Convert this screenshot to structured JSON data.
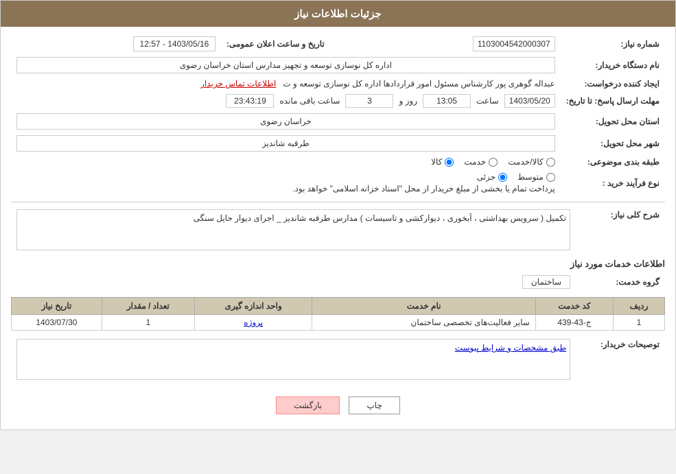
{
  "header": {
    "title": "جزئیات اطلاعات نیاز"
  },
  "fields": {
    "need_number_label": "شماره نیاز:",
    "need_number_value": "1103004542000307",
    "announce_datetime_label": "تاریخ و ساعت اعلان عمومی:",
    "announce_datetime_value": "1403/05/16 - 12:57",
    "buyer_org_label": "نام دستگاه خریدار:",
    "buyer_org_value": "اداره کل نوسازی  توسعه و تجهیز مدارس استان خراسان رضوی",
    "requester_label": "ایجاد کننده درخواست:",
    "requester_value": "عبداله گوهری پور کارشناس مسئول امور قراردادها  اداره کل نوسازی  توسعه و ت",
    "requester_link": "اطلاعات تماس خریدار",
    "response_deadline_label": "مهلت ارسال پاسخ: تا تاریخ:",
    "response_date": "1403/05/20",
    "response_time_label": "ساعت",
    "response_time": "13:05",
    "response_days_label": "روز و",
    "response_days": "3",
    "remaining_time_label": "ساعت باقی مانده",
    "remaining_time": "23:43:19",
    "province_label": "استان محل تحویل:",
    "province_value": "خراسان رضوی",
    "city_label": "شهر محل تحویل:",
    "city_value": "طرقبه شاندیز",
    "category_label": "طبقه بندی موضوعی:",
    "category_kala": "کالا",
    "category_khedmat": "خدمت",
    "category_kala_khedmat": "کالا/خدمت",
    "category_selected": "کالا",
    "process_label": "نوع فرآیند خرید :",
    "process_jozee": "جزئی",
    "process_motavaset": "متوسط",
    "process_note": "پرداخت تمام یا بخشی از مبلغ خریدار از محل \"اسناد خزانه اسلامی\" خواهد بود.",
    "description_label": "شرح کلی نیاز:",
    "description_value": "تکمیل ( سرویس بهداشتی ، آبخوری ، دیوارکشی و تاسیسات ) مدارس طرقبه شاندیز _ اجرای دیوار حایل سنگی",
    "services_section_label": "اطلاعات خدمات مورد نیاز",
    "service_group_label": "گروه خدمت:",
    "service_group_value": "ساختمان",
    "table_headers": {
      "radif": "ردیف",
      "code": "کد خدمت",
      "name": "نام خدمت",
      "unit": "واحد اندازه گیری",
      "quantity": "تعداد / مقدار",
      "date": "تاریخ نیاز"
    },
    "table_rows": [
      {
        "radif": "1",
        "code": "ج-43-439",
        "name": "سایر فعالیت‌های تخصصی ساختمان",
        "unit": "پروژه",
        "quantity": "1",
        "date": "1403/07/30"
      }
    ],
    "buyer_description_label": "توصیحات خریدار:",
    "buyer_description_value": "طبق مشخصات و شرایط پیوست"
  },
  "buttons": {
    "print": "چاپ",
    "back": "بازگشت"
  }
}
